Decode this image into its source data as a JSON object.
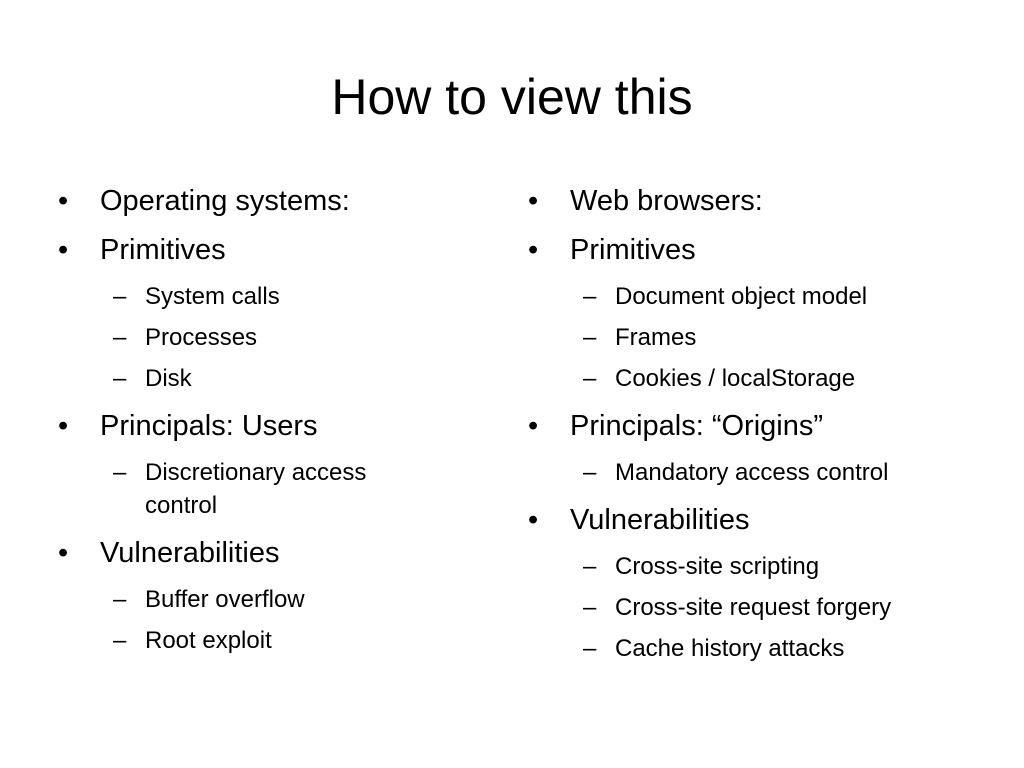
{
  "slide": {
    "title": "How to view this",
    "left_column": [
      {
        "level": 1,
        "text": "Operating systems:"
      },
      {
        "level": 1,
        "text": "Primitives"
      },
      {
        "level": 2,
        "text": "System calls"
      },
      {
        "level": 2,
        "text": "Processes"
      },
      {
        "level": 2,
        "text": "Disk"
      },
      {
        "level": 1,
        "text": "Principals: Users"
      },
      {
        "level": 2,
        "text": "Discretionary access control"
      },
      {
        "level": 1,
        "text": "Vulnerabilities"
      },
      {
        "level": 2,
        "text": "Buffer overflow"
      },
      {
        "level": 2,
        "text": "Root exploit"
      }
    ],
    "right_column": [
      {
        "level": 1,
        "text": "Web browsers:"
      },
      {
        "level": 1,
        "text": "Primitives"
      },
      {
        "level": 2,
        "text": "Document object model"
      },
      {
        "level": 2,
        "text": "Frames"
      },
      {
        "level": 2,
        "text": "Cookies / localStorage"
      },
      {
        "level": 1,
        "text": "Principals: “Origins”"
      },
      {
        "level": 2,
        "text": "Mandatory access control"
      },
      {
        "level": 1,
        "text": "Vulnerabilities"
      },
      {
        "level": 2,
        "text": "Cross-site scripting"
      },
      {
        "level": 2,
        "text": "Cross-site request forgery"
      },
      {
        "level": 2,
        "text": "Cache history attacks"
      }
    ],
    "bullet_marks": {
      "level1": "•",
      "level2": "–"
    }
  }
}
